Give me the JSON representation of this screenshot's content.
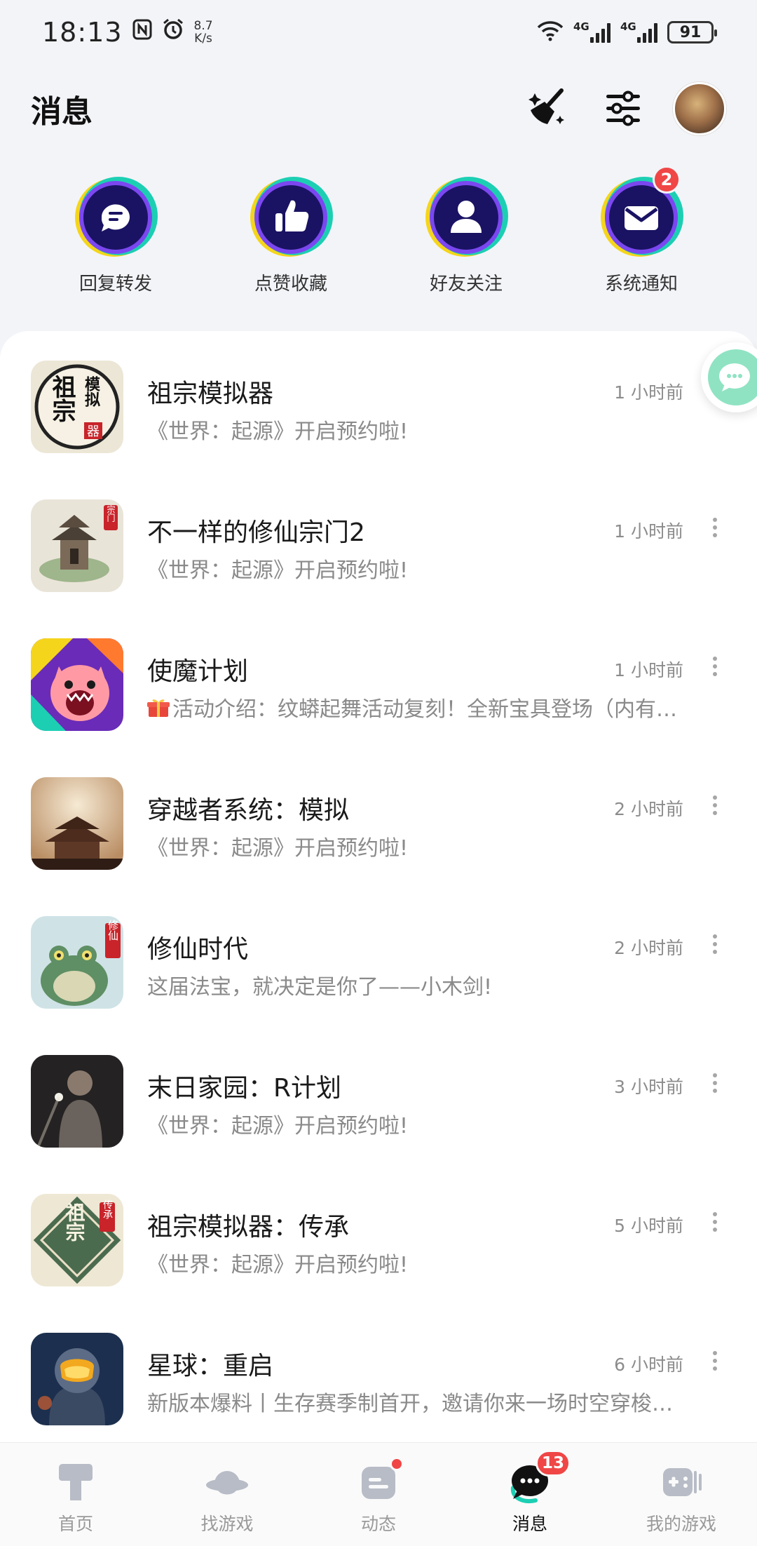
{
  "status_bar": {
    "time": "18:13",
    "net_speed_value": "8.7",
    "net_speed_unit": "K/s",
    "sim1": "4G",
    "sim2": "4G",
    "battery": "91"
  },
  "header": {
    "title": "消息"
  },
  "quick_entries": [
    {
      "label": "回复转发",
      "icon": "chat-bubble-icon"
    },
    {
      "label": "点赞收藏",
      "icon": "thumbs-up-icon"
    },
    {
      "label": "好友关注",
      "icon": "person-icon"
    },
    {
      "label": "系统通知",
      "icon": "envelope-icon",
      "badge": "2"
    }
  ],
  "messages": [
    {
      "title": "祖宗模拟器",
      "time": "1 小时前",
      "subtitle": "《世界：起源》开启预约啦!"
    },
    {
      "title": "不一样的修仙宗门2",
      "time": "1 小时前",
      "subtitle": "《世界：起源》开启预约啦!"
    },
    {
      "title": "使魔计划",
      "time": "1 小时前",
      "subtitle": "活动介绍：纹蟒起舞活动复刻！全新宝具登场（内有…"
    },
    {
      "title": "穿越者系统：模拟",
      "time": "2 小时前",
      "subtitle": "《世界：起源》开启预约啦!"
    },
    {
      "title": "修仙时代",
      "time": "2 小时前",
      "subtitle": "这届法宝，就决定是你了——小木剑!"
    },
    {
      "title": "末日家园：R计划",
      "time": "3 小时前",
      "subtitle": "《世界：起源》开启预约啦!"
    },
    {
      "title": "祖宗模拟器：传承",
      "time": "5 小时前",
      "subtitle": "《世界：起源》开启预约啦!"
    },
    {
      "title": "星球：重启",
      "time": "6 小时前",
      "subtitle": "新版本爆料丨生存赛季制首开，邀请你来一场时空穿梭…"
    }
  ],
  "thumb_text": {
    "t1_a": "模拟",
    "t1_b": "祖宗",
    "t1_c": "器",
    "t2": "宗门",
    "t5": "修仙",
    "t7_a": "祖宗",
    "t7_b": "传承"
  },
  "bottom_nav": [
    {
      "label": "首页",
      "icon": "home-icon"
    },
    {
      "label": "找游戏",
      "icon": "planet-icon"
    },
    {
      "label": "动态",
      "icon": "feed-icon"
    },
    {
      "label": "消息",
      "icon": "message-icon",
      "badge": "13",
      "active": true
    },
    {
      "label": "我的游戏",
      "icon": "gamepad-icon"
    }
  ],
  "colors": {
    "accent_teal": "#1ccfb3",
    "accent_yellow": "#f5d51c",
    "accent_purple": "#7b47f0",
    "badge_red": "#f04646",
    "icon_navy": "#1a1363"
  }
}
